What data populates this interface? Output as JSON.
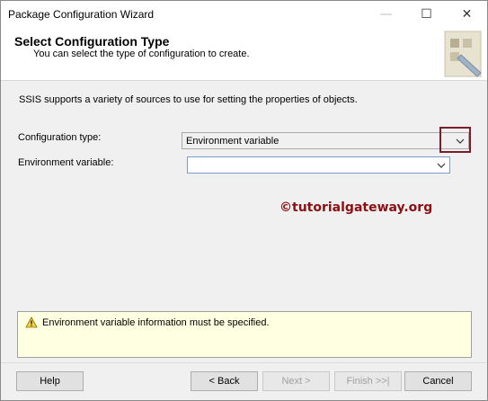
{
  "window": {
    "title": "Package Configuration Wizard"
  },
  "header": {
    "title": "Select Configuration Type",
    "subtitle": "You can select the type of configuration to create."
  },
  "intro": "SSIS supports a variety of sources to use for setting the properties of objects.",
  "form": {
    "config_type_label": "Configuration type:",
    "config_type_value": "Environment variable",
    "env_var_label": "Environment variable:",
    "env_var_value": ""
  },
  "watermark": "©tutorialgateway.org",
  "message": "Environment variable information must be specified.",
  "buttons": {
    "help": "Help",
    "back": "< Back",
    "next": "Next >",
    "finish": "Finish >>|",
    "cancel": "Cancel"
  }
}
